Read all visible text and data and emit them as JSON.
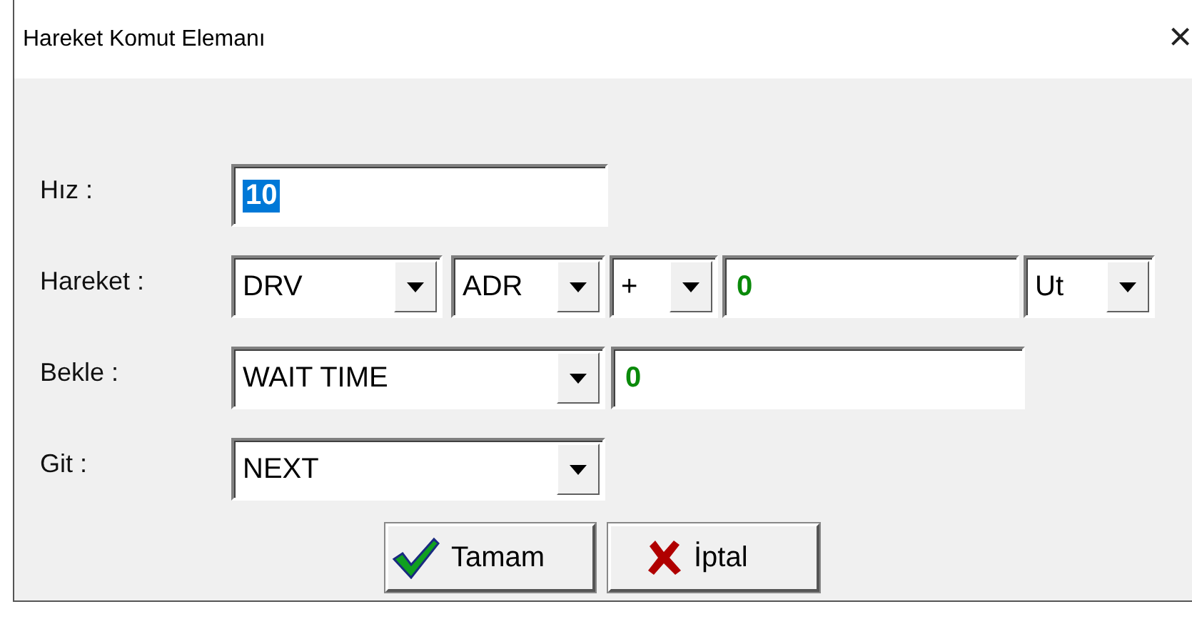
{
  "window": {
    "title": "Hareket Komut Elemanı",
    "close": "×"
  },
  "rows": [
    {
      "label": "Hız :",
      "controls": [
        {
          "kind": "field",
          "value": "10",
          "highlighted": true
        }
      ]
    },
    {
      "label": "Hareket :",
      "controls": [
        {
          "kind": "combo",
          "value": "DRV"
        },
        {
          "kind": "combo",
          "value": "ADR"
        },
        {
          "kind": "combo",
          "value": "+"
        },
        {
          "kind": "field",
          "value": "0",
          "highlighted": false
        },
        {
          "kind": "combo",
          "value": "Ut"
        }
      ]
    },
    {
      "label": "Bekle :",
      "controls": [
        {
          "kind": "combo",
          "value": "WAIT TIME"
        },
        {
          "kind": "field",
          "value": "0",
          "highlighted": false
        }
      ]
    },
    {
      "label": "Git :",
      "controls": [
        {
          "kind": "combo",
          "value": "NEXT"
        }
      ]
    }
  ],
  "buttons": [
    {
      "kind": "ok",
      "label": "Tamam"
    },
    {
      "kind": "cancel",
      "label": "İptal"
    }
  ]
}
